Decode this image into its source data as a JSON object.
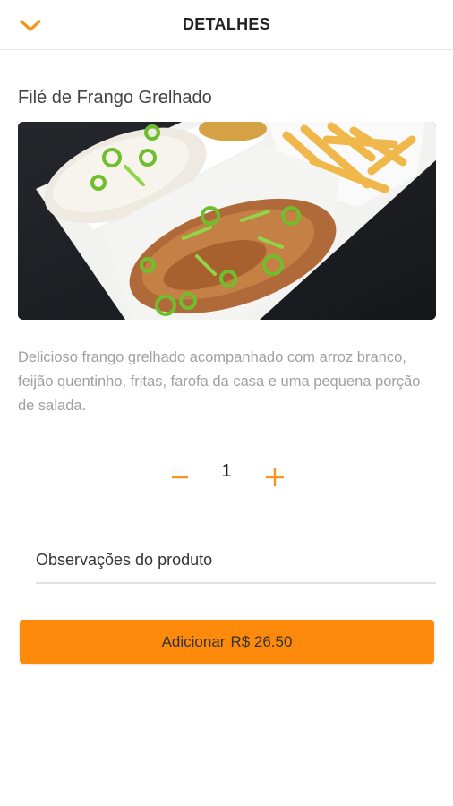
{
  "colors": {
    "accent": "#fd8a0a",
    "header_icon": "#f7941d"
  },
  "header": {
    "title": "DETALHES",
    "back_icon": "chevron-down-icon"
  },
  "product": {
    "name": "Filé de Frango Grelhado",
    "image_icon": "food-photo",
    "description": "Delicioso frango grelhado acompanhado com arroz branco, feijão quentinho, fritas, farofa da casa e uma pequena porção de salada."
  },
  "quantity": {
    "value": "1",
    "minus_icon": "minus-icon",
    "plus_icon": "plus-icon"
  },
  "notes": {
    "placeholder": "Observações do produto",
    "value": ""
  },
  "add_button": {
    "label": "Adicionar",
    "price": "R$ 26.50"
  }
}
